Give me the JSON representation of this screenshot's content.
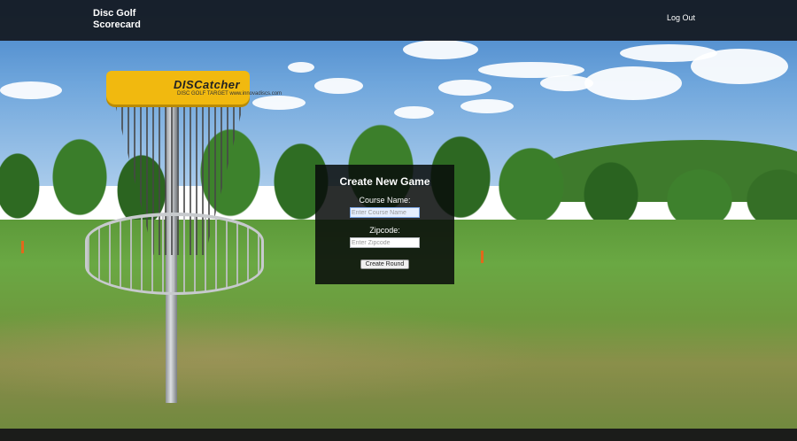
{
  "navbar": {
    "brand_line1": "Disc Golf",
    "brand_line2": "Scorecard",
    "logout_label": "Log Out"
  },
  "form": {
    "title": "Create New Game",
    "course_label": "Course Name:",
    "course_placeholder": "Enter Course Name",
    "course_value": "",
    "zip_label": "Zipcode:",
    "zip_placeholder": "Enter Zipcode",
    "zip_value": "",
    "submit_label": "Create Round"
  },
  "background": {
    "basket_brand": "DISCatcher",
    "basket_subtitle": "DISC GOLF TARGET  www.innovadiscs.com"
  },
  "colors": {
    "navbar_bg": "#14181e",
    "panel_bg": "#080c0a",
    "basket_band": "#f1b90f"
  }
}
